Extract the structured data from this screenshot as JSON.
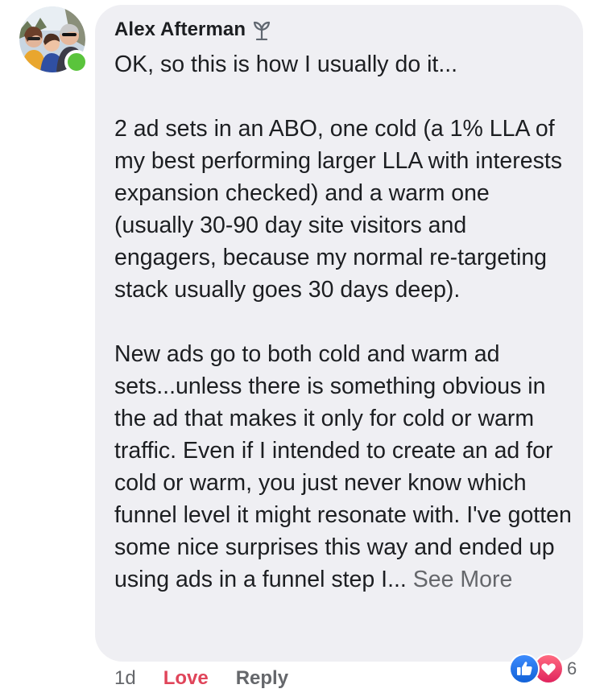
{
  "comment": {
    "author": "Alex Afterman",
    "paragraphs": [
      "OK, so this is how I usually do it...",
      "2 ad sets in an ABO, one cold (a 1% LLA of my best performing larger LLA with interests expansion checked) and a warm one (usually 30-90 day site visitors and engagers, because  my normal re-targeting stack usually goes 30 days deep).",
      "New ads go to both cold and warm ad sets...unless there is something obvious in the ad that makes it only for cold or warm traffic.  Even if I intended to create an ad for cold or warm, you just never know which funnel level it might resonate with.  I've gotten some nice surprises this way and ended up using ads in a funnel step I..."
    ],
    "see_more": "See More"
  },
  "actions": {
    "time": "1d",
    "love": "Love",
    "reply": "Reply"
  },
  "reactions": {
    "icons": [
      "like-reaction-icon",
      "love-reaction-icon"
    ],
    "count": "6"
  },
  "colors": {
    "bubble": "#efeff3",
    "love": "#e0455a",
    "online": "#5ac43c",
    "like": "#1877f2"
  }
}
